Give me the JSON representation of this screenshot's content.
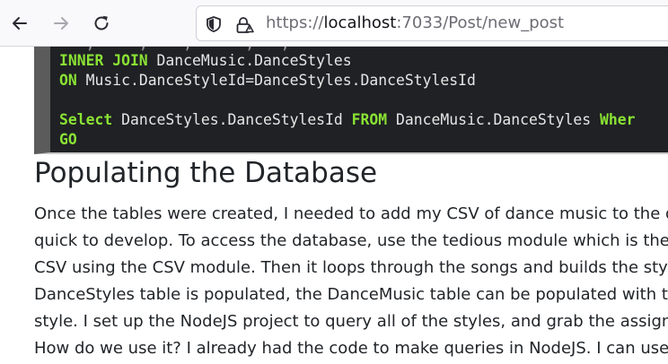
{
  "browser": {
    "back_icon": "arrow-left-icon",
    "forward_icon": "arrow-right-icon",
    "reload_icon": "reload-icon",
    "shield_icon": "shield-icon",
    "lock_icon": "lock-icon",
    "url": {
      "scheme": "https://",
      "host": "localhost",
      "rest": ":7033/Post/new_post"
    }
  },
  "code": {
    "line1": {
      "kw": "INNER JOIN",
      "text": " DanceMusic.DanceStyles"
    },
    "line2": {
      "kw": "ON",
      "text": " Music.DanceStyleId=DanceStyles.DanceStylesId"
    },
    "line3": {
      "kw1": "Select",
      "text1": " DanceStyles.DanceStylesId ",
      "kw2": "FROM",
      "text2": " DanceMusic.DanceStyles ",
      "kw3": "Wher"
    },
    "line4": {
      "kw": "GO"
    }
  },
  "article": {
    "heading": "Populating the Database",
    "lines": [
      "Once the tables were created, I needed to add my CSV of dance music to the dat",
      "quick to develop. To access the database, use the tedious module which is the M",
      "CSV using the CSV module. Then it loops through the songs and builds the style",
      "DanceStyles table is populated, the DanceMusic table can be populated with the",
      "style. I set up the NodeJS project to query all of the styles, and grab the assigne",
      "How do we use it? I already had the code to make queries in NodeJS. I can use t"
    ]
  },
  "colors": {
    "code_bg": "#1f2124",
    "code_keyword": "#8ae234",
    "code_text": "#e6e6e6",
    "text": "#212529",
    "toolbar_bg": "#f9f9fb"
  }
}
